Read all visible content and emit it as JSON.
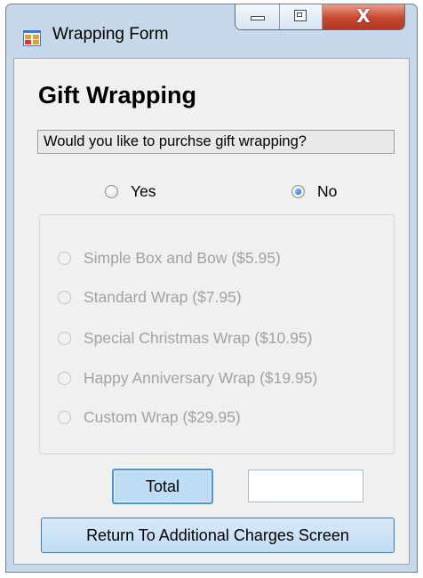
{
  "window": {
    "title": "Wrapping Form",
    "controls": {
      "minimize": "minimize",
      "maximize": "maximize",
      "close": "X"
    }
  },
  "form": {
    "heading": "Gift Wrapping",
    "question": "Would you like to purchse gift wrapping?",
    "choices": [
      {
        "label": "Yes",
        "checked": false
      },
      {
        "label": "No",
        "checked": true
      }
    ],
    "wrap_options": [
      {
        "label": "Simple Box and Bow ($5.95)",
        "enabled": false
      },
      {
        "label": "Standard Wrap ($7.95)",
        "enabled": false
      },
      {
        "label": "Special Christmas Wrap ($10.95)",
        "enabled": false
      },
      {
        "label": "Happy Anniversary Wrap ($19.95)",
        "enabled": false
      },
      {
        "label": "Custom Wrap ($29.95)",
        "enabled": false
      }
    ],
    "total_button": "Total",
    "total_value": "",
    "return_button": "Return To Additional Charges Screen"
  },
  "colors": {
    "window_frame": "#c6d8ea",
    "client_background": "#f0f0f0",
    "close_button": "#c8462e",
    "focused_button": "#bfdcf5",
    "disabled_text": "#a2a2a2"
  },
  "icons": {
    "app": "windows-form-icon",
    "radio_checked": "radio-checked-icon",
    "radio_unchecked": "radio-unchecked-icon"
  }
}
